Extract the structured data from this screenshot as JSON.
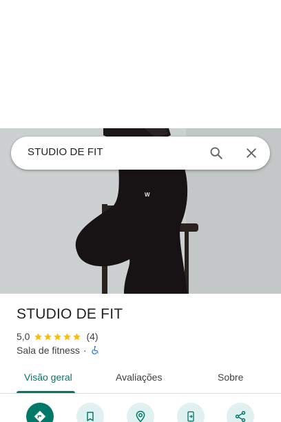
{
  "search": {
    "query": "STUDIO DE FIT"
  },
  "place": {
    "name": "STUDIO DE FIT",
    "rating": "5,0",
    "stars": 5,
    "review_count": "(4)",
    "category": "Sala de fitness",
    "separator": "·"
  },
  "tabs": [
    {
      "label": "Visão geral",
      "active": true
    },
    {
      "label": "Avaliações",
      "active": false
    },
    {
      "label": "Sobre",
      "active": false
    }
  ],
  "actions": [
    {
      "icon": "directions-icon"
    },
    {
      "icon": "bookmark-icon"
    },
    {
      "icon": "nearby-icon"
    },
    {
      "icon": "send-to-phone-icon"
    },
    {
      "icon": "share-icon"
    }
  ],
  "colors": {
    "accent": "#00796b",
    "accent_light": "#dff1f0",
    "star": "#fbbc04",
    "accessibility": "#1a73e8"
  }
}
